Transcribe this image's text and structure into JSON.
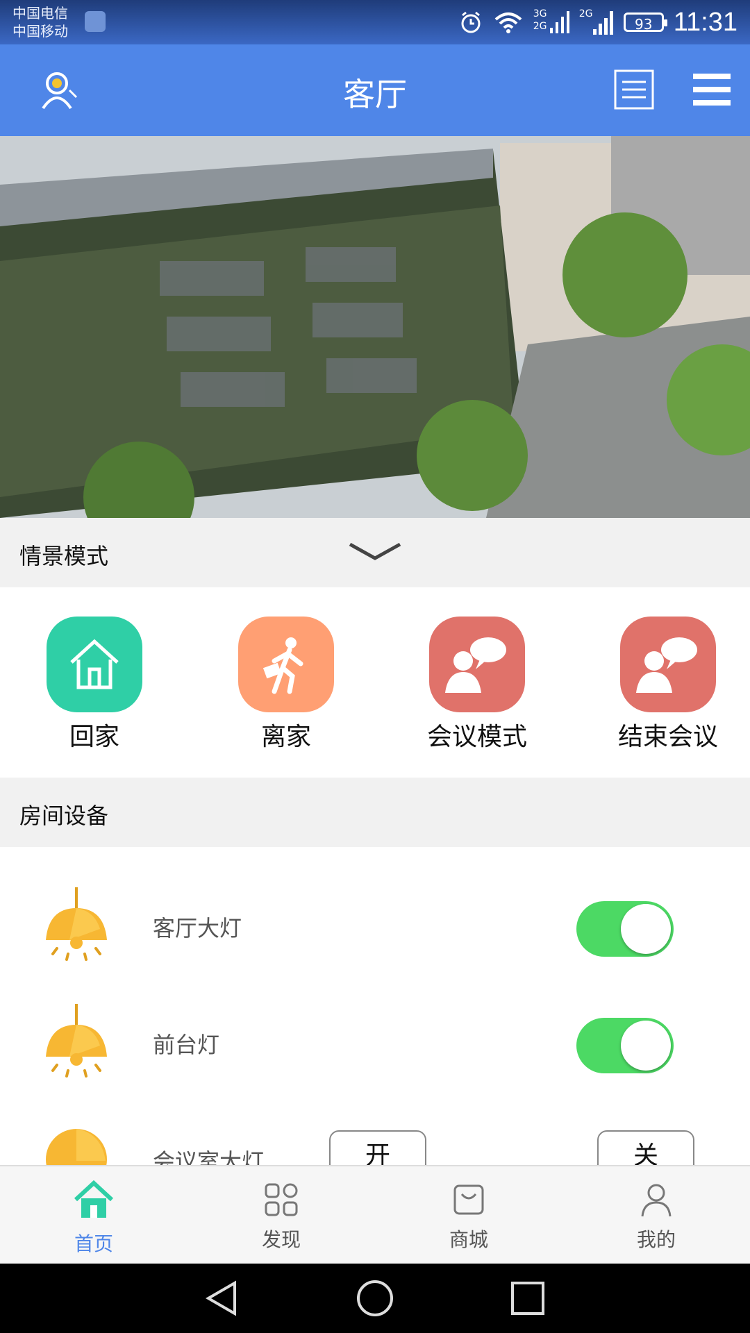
{
  "status_bar": {
    "carrier_1": "中国电信",
    "carrier_2": "中国移动",
    "net_3g": "3G",
    "net_2g_a": "2G",
    "net_2g_b": "2G",
    "battery": "93",
    "time": "11:31"
  },
  "header": {
    "title": "客厅",
    "left_icon": "camera-user-icon",
    "right_icons": [
      "list-icon",
      "menu-icon"
    ]
  },
  "scene_section": {
    "title": "情景模式",
    "scenes": [
      {
        "label": "回家",
        "icon": "home-icon",
        "color": "#2fcfa6"
      },
      {
        "label": "离家",
        "icon": "walking-person-icon",
        "color": "#ff9f73"
      },
      {
        "label": "会议模式",
        "icon": "meeting-icon",
        "color": "#e0726a"
      },
      {
        "label": "结束会议",
        "icon": "meeting-icon",
        "color": "#e0726a"
      }
    ]
  },
  "devices_section": {
    "title": "房间设备",
    "devices": [
      {
        "label": "客厅大灯",
        "control": "toggle",
        "on": true
      },
      {
        "label": "前台灯",
        "control": "toggle",
        "on": true
      },
      {
        "label": "会议室大灯",
        "control": "buttons",
        "on_label": "开",
        "off_label": "关"
      }
    ]
  },
  "bottom_nav": {
    "items": [
      {
        "label": "首页",
        "icon": "home-icon",
        "active": true
      },
      {
        "label": "发现",
        "icon": "discover-grid-icon",
        "active": false
      },
      {
        "label": "商城",
        "icon": "shopping-bag-icon",
        "active": false
      },
      {
        "label": "我的",
        "icon": "profile-icon",
        "active": false
      }
    ]
  },
  "colors": {
    "accent": "#4f86e8",
    "toggle_on": "#4cd964",
    "lamp": "#f7b733"
  }
}
